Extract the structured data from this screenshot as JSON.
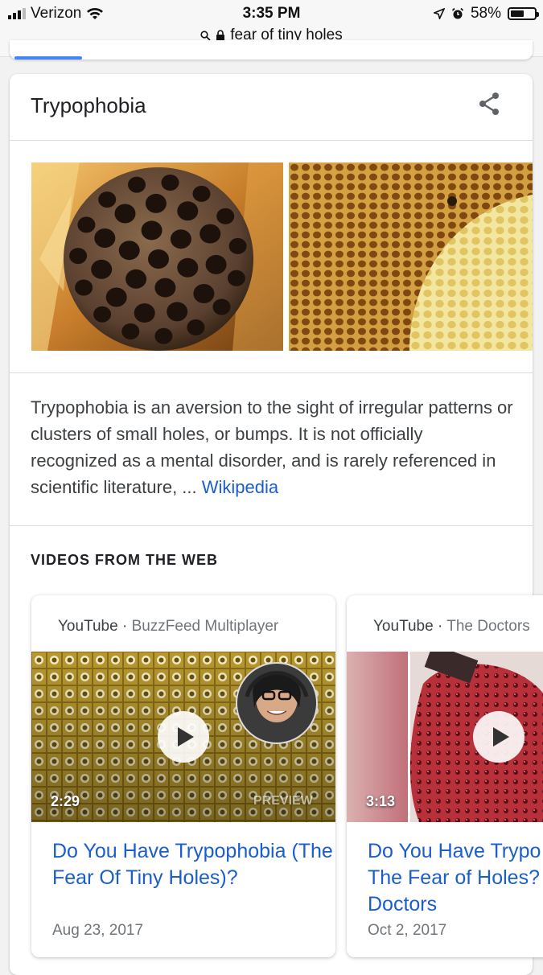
{
  "status_bar": {
    "carrier": "Verizon",
    "time": "3:35 PM",
    "battery": "58%",
    "battery_level": 0.58,
    "url": "fear of tiny holes"
  },
  "knowledge_panel": {
    "title": "Trypophobia",
    "description": "Trypophobia is an aversion to the sight of irregular patterns or clusters of small holes, or bumps. It is not officially recognized as a mental disorder, and is rarely referenced in scientific literature, ...",
    "source_link": "Wikipedia",
    "share_icon": "share-icon",
    "images": [
      "lotus-seed-pod",
      "honeycomb"
    ]
  },
  "videos": {
    "heading": "VIDEOS FROM THE WEB",
    "items": [
      {
        "platform": "YouTube",
        "separator": " · ",
        "channel": "BuzzFeed Multiplayer",
        "duration": "2:29",
        "overlay": "PREVIEW",
        "title": "Do You Have Trypophobia (The Fear Of Tiny Holes)?",
        "date": "Aug 23, 2017"
      },
      {
        "platform": "YouTube",
        "separator": " · ",
        "channel": "The Doctors",
        "duration": "3:13",
        "title": "Do You Have Trypo The Fear of Holes? Doctors",
        "date": "Oct 2, 2017"
      }
    ]
  },
  "colors": {
    "link": "#1a5dcc",
    "accent_blue": "#4285f4"
  }
}
